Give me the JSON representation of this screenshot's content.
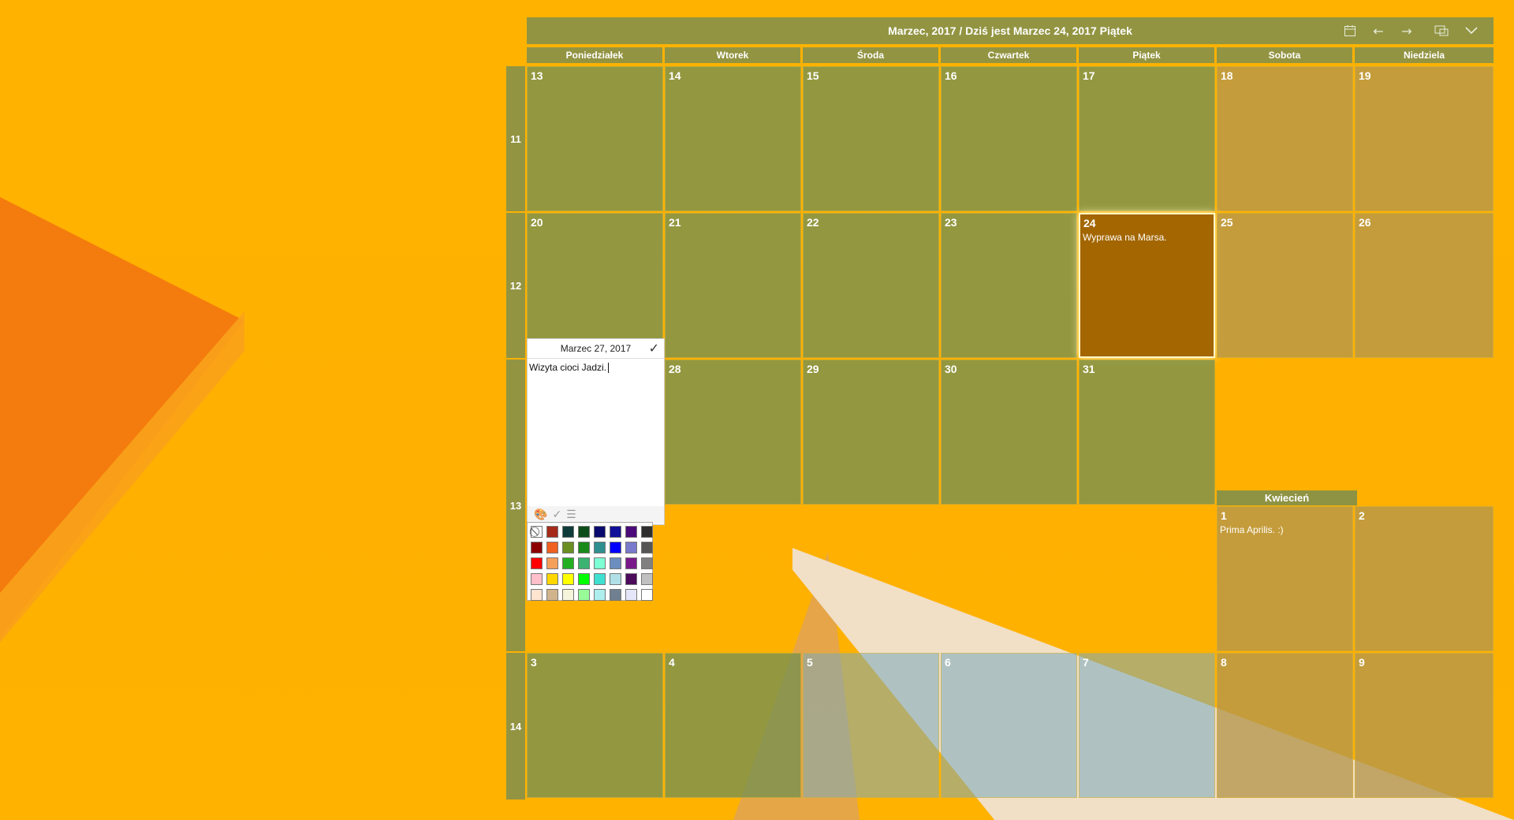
{
  "header": {
    "title": "Marzec, 2017 / Dziś jest Marzec 24, 2017 Piątek"
  },
  "icons": {
    "calendar": "calendar-icon",
    "prev": "arrow-left-icon",
    "next": "arrow-right-icon",
    "window": "window-icon",
    "dropdown": "chevron-down-icon"
  },
  "day_headers": [
    "Poniedziałek",
    "Wtorek",
    "Środa",
    "Czwartek",
    "Piątek",
    "Sobota",
    "Niedziela"
  ],
  "weeks": [
    "11",
    "12",
    "13",
    "14"
  ],
  "april_label": "Kwiecień",
  "cells": {
    "r1": [
      "13",
      "14",
      "15",
      "16",
      "17",
      "18",
      "19"
    ],
    "r2": [
      "20",
      "21",
      "22",
      "23",
      "24",
      "25",
      "26"
    ],
    "r3": [
      "28",
      "29",
      "30",
      "31"
    ],
    "r3_april": [
      "1",
      "2"
    ],
    "r4": [
      "3",
      "4",
      "5",
      "6",
      "7",
      "8",
      "9"
    ]
  },
  "events": {
    "mar24": "Wyprawa na Marsa.",
    "apr1": "Prima Aprilis. :)"
  },
  "editor": {
    "date": "Marzec 27, 2017",
    "text": "Wizyta cioci Jadzi."
  },
  "palette_colors": [
    "#ffffff",
    "#a52a1a",
    "#0f3b3b",
    "#0d4d1a",
    "#0a0a6e",
    "#101098",
    "#4b0a7a",
    "#2e2e2e",
    "#8b0000",
    "#f06020",
    "#6b8e23",
    "#1a8a1a",
    "#2f8f8f",
    "#0000ff",
    "#7a7acc",
    "#555555",
    "#ff0000",
    "#f5a05a",
    "#22b022",
    "#3cb371",
    "#7fffd4",
    "#6c8ebf",
    "#7a1a8a",
    "#808080",
    "#ffc0cb",
    "#ffd700",
    "#ffff00",
    "#00ff00",
    "#40e0d0",
    "#b0e0e6",
    "#4b0a5a",
    "#c0c0c0",
    "#ffe4d0",
    "#d2b48c",
    "#f5f5dc",
    "#98fb98",
    "#afeeee",
    "#708090",
    "#e6e6fa",
    "#ffffff"
  ]
}
